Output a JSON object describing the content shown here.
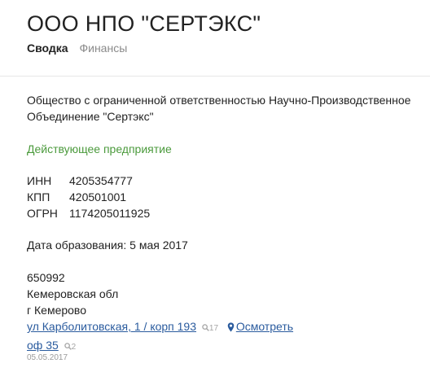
{
  "company": {
    "title": "ООО НПО \"СЕРТЭКС\"",
    "full_name_line1": "Общество с ограниченной ответственностью Научно-Производственное",
    "full_name_line2": "Объединение \"Сертэкс\"",
    "status": "Действующее предприятие",
    "status_color": "#4b9a3c"
  },
  "tabs": [
    {
      "label": "Сводка",
      "active": true
    },
    {
      "label": "Финансы",
      "active": false
    }
  ],
  "requisites": [
    {
      "label": "ИНН",
      "value": "4205354777"
    },
    {
      "label": "КПП",
      "value": "420501001"
    },
    {
      "label": "ОГРН",
      "value": "1174205011925"
    }
  ],
  "registration": {
    "text": "Дата образования: 5 мая 2017"
  },
  "address": {
    "postal_code": "650992",
    "region": "Кемеровская обл",
    "city": "г Кемерово",
    "street": "ул Карболитовская, 1 / корп 193",
    "street_count": "17",
    "map_label": "Осмотреть",
    "office": "оф 35",
    "office_count": "2",
    "date": "05.05.2017",
    "link_color": "#2a5b9e"
  },
  "icons": {
    "search": "magnifier-icon",
    "map": "map-pin-icon"
  }
}
